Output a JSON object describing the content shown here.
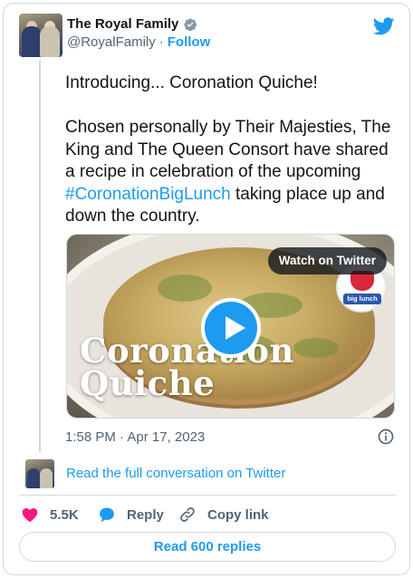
{
  "author": {
    "display_name": "The Royal Family",
    "handle": "@RoyalFamily",
    "separator": "·",
    "follow_label": "Follow",
    "verified": true
  },
  "tweet": {
    "line1": "Introducing... Coronation Quiche!",
    "body_prefix": "Chosen personally by Their Majesties, The King and The Queen Consort have shared a recipe in celebration of the upcoming ",
    "hashtag": "#CoronationBigLunch",
    "body_suffix": " taking place up and down the country."
  },
  "media": {
    "overlay_title_line1": "Coronation",
    "overlay_title_line2": "Quiche",
    "watch_label": "Watch on Twitter",
    "badge_text": "big lunch"
  },
  "meta": {
    "timestamp": "1:58 PM · Apr 17, 2023"
  },
  "conversation": {
    "link_label": "Read the full conversation on Twitter"
  },
  "actions": {
    "likes_count": "5.5K",
    "reply_label": "Reply",
    "copy_link_label": "Copy link"
  },
  "footer": {
    "read_replies_label": "Read 600 replies"
  },
  "colors": {
    "accent": "#1d9bf0",
    "like": "#f91880",
    "text": "#0f1419",
    "secondary": "#536471",
    "border": "#cfd9de"
  },
  "icons": {
    "verified": "verified-badge-icon",
    "brand": "twitter-bird-icon",
    "info": "info-icon",
    "like": "heart-icon",
    "reply": "speech-bubble-icon",
    "copy_link": "link-icon",
    "play": "play-icon"
  }
}
